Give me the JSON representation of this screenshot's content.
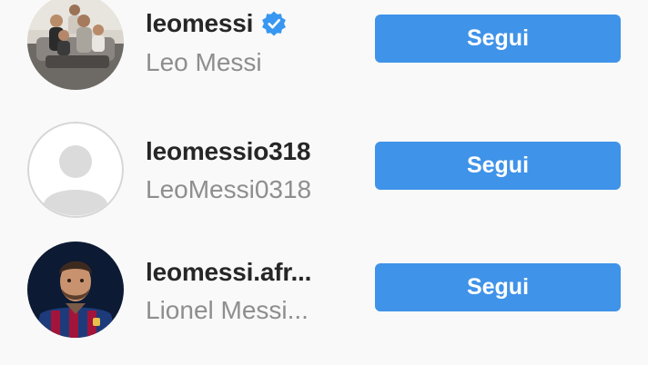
{
  "results": [
    {
      "username": "leomessi",
      "full_name": "Leo Messi",
      "verified": true,
      "avatar_icon": "family-photo-avatar",
      "follow_label": "Segui"
    },
    {
      "username": "leomessio318",
      "full_name": "LeoMessi0318",
      "verified": false,
      "avatar_icon": "default-profile-avatar",
      "follow_label": "Segui"
    },
    {
      "username": "leomessi.afr...",
      "full_name": "Lionel Messi...",
      "verified": false,
      "avatar_icon": "player-photo-avatar",
      "follow_label": "Segui"
    }
  ],
  "colors": {
    "background": "#f9f9f9",
    "button": "#3f93e8",
    "button_text": "#ffffff",
    "username": "#262626",
    "full_name": "#8e8e8e",
    "verified_badge": "#3897f0"
  }
}
